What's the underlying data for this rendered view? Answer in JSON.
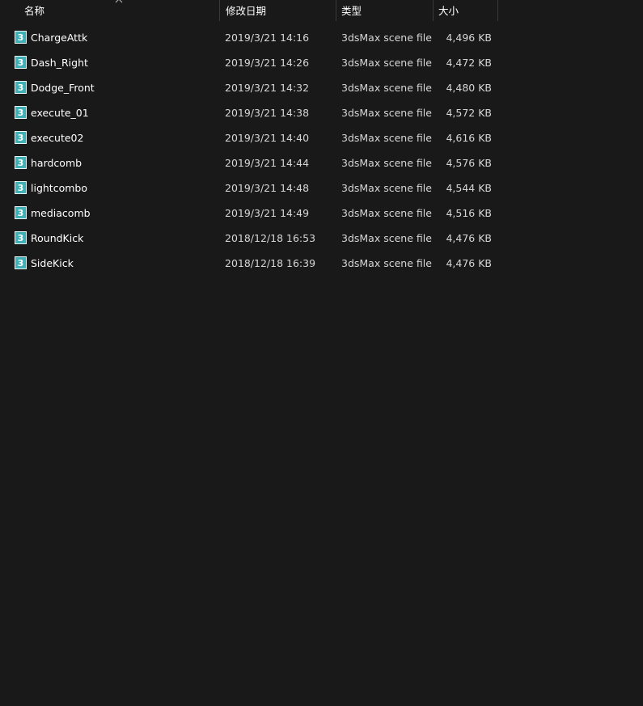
{
  "columns": {
    "name": "名称",
    "date": "修改日期",
    "type": "类型",
    "size": "大小"
  },
  "sort_indicator": "chevron-up-icon",
  "colors": {
    "background": "#191919",
    "text": "#ffffff",
    "secondary_text": "#d6d6d6",
    "icon_teal": "#3fb0b5"
  },
  "files": [
    {
      "name": "ChargeAttk",
      "date": "2019/3/21 14:16",
      "type": "3dsMax scene file",
      "size": "4,496 KB"
    },
    {
      "name": "Dash_Right",
      "date": "2019/3/21 14:26",
      "type": "3dsMax scene file",
      "size": "4,472 KB"
    },
    {
      "name": "Dodge_Front",
      "date": "2019/3/21 14:32",
      "type": "3dsMax scene file",
      "size": "4,480 KB"
    },
    {
      "name": "execute_01",
      "date": "2019/3/21 14:38",
      "type": "3dsMax scene file",
      "size": "4,572 KB"
    },
    {
      "name": "execute02",
      "date": "2019/3/21 14:40",
      "type": "3dsMax scene file",
      "size": "4,616 KB"
    },
    {
      "name": "hardcomb",
      "date": "2019/3/21 14:44",
      "type": "3dsMax scene file",
      "size": "4,576 KB"
    },
    {
      "name": "lightcombo",
      "date": "2019/3/21 14:48",
      "type": "3dsMax scene file",
      "size": "4,544 KB"
    },
    {
      "name": "mediacomb",
      "date": "2019/3/21 14:49",
      "type": "3dsMax scene file",
      "size": "4,516 KB"
    },
    {
      "name": "RoundKick",
      "date": "2018/12/18 16:53",
      "type": "3dsMax scene file",
      "size": "4,476 KB"
    },
    {
      "name": "SideKick",
      "date": "2018/12/18 16:39",
      "type": "3dsMax scene file",
      "size": "4,476 KB"
    }
  ]
}
